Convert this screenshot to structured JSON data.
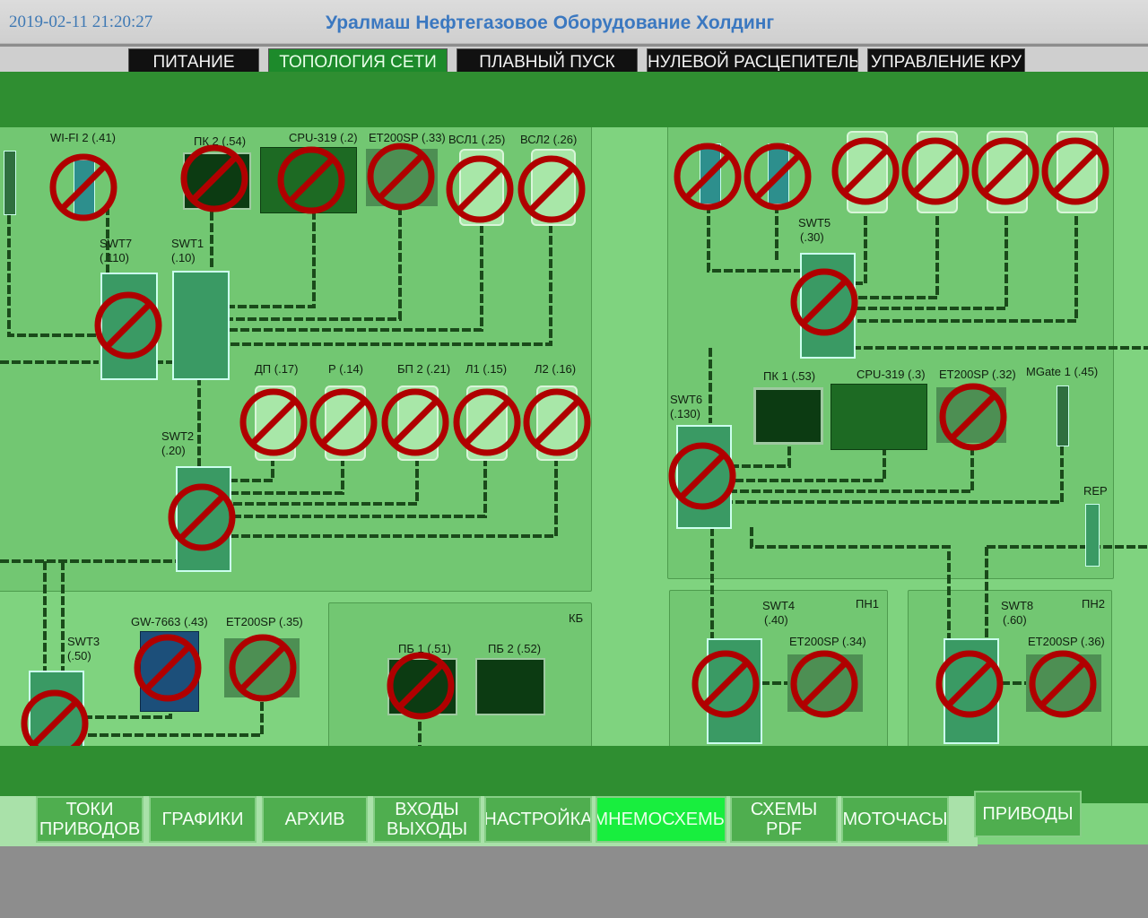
{
  "header": {
    "datetime": "2019-02-11 21:20:27",
    "company": "Уралмаш Нефтегазовое Оборудование Холдинг"
  },
  "top_tabs": [
    "ПИТАНИЕ",
    "ТОПОЛОГИЯ СЕТИ",
    "ПЛАВНЫЙ ПУСК",
    "НУЛЕВОЙ РАСЦЕПИТЕЛЬ",
    "УПРАВЛЕНИЕ КРУ"
  ],
  "top_tabs_active": "ТОПОЛОГИЯ СЕТИ",
  "labels": {
    "wifi2": "WI-FI 2  (.41)",
    "pk2": "ПК 2 (.54)",
    "cpu319_2": "CPU-319 (.2)",
    "et200sp_33": "ET200SP (.33)",
    "vsl1": "ВСЛ1 (.25)",
    "vsl2": "ВСЛ2 (.26)",
    "swt7": "SWT7",
    "swt7_ip": "(.110)",
    "swt1": "SWT1",
    "swt1_ip": "(.10)",
    "dp": "ДП (.17)",
    "r": "Р (.14)",
    "bp2": "БП 2 (.21)",
    "l1": "Л1 (.15)",
    "l2": "Л2 (.16)",
    "swt2": "SWT2",
    "swt2_ip": "(.20)",
    "gw7663": "GW-7663 (.43)",
    "et200sp_35": "ET200SP (.35)",
    "swt3": "SWT3",
    "swt3_ip": "(.50)",
    "kb": "КБ",
    "pb1": "ПБ 1 (.51)",
    "pb2": "ПБ 2 (.52)",
    "swt5": "SWT5",
    "swt5_ip": "(.30)",
    "pk1": "ПК 1 (.53)",
    "cpu319_3": "CPU-319 (.3)",
    "et200sp_32": "ET200SP (.32)",
    "mgate1": "MGate 1 (.45)",
    "swt6": "SWT6",
    "swt6_ip": "(.130)",
    "rep": "REP",
    "swt4": "SWT4",
    "swt4_ip": "(.40)",
    "pn1": "ПН1",
    "et200sp_34": "ET200SP (.34)",
    "swt8": "SWT8",
    "swt8_ip": "(.60)",
    "pn2": "ПН2",
    "et200sp_36": "ET200SP (.36)"
  },
  "bottom_nav": [
    {
      "line1": "ТОКИ",
      "line2": "ПРИВОДОВ",
      "active": false
    },
    {
      "line1": "ГРАФИКИ",
      "line2": "",
      "active": false
    },
    {
      "line1": "АРХИВ",
      "line2": "",
      "active": false
    },
    {
      "line1": "ВХОДЫ",
      "line2": "ВЫХОДЫ",
      "active": false
    },
    {
      "line1": "НАСТРОЙКА",
      "line2": "",
      "active": false
    },
    {
      "line1": "МНЕМОСХЕМЫ",
      "line2": "",
      "active": true
    },
    {
      "line1": "СХЕМЫ",
      "line2": "PDF",
      "active": false
    },
    {
      "line1": "МОТОЧАСЫ",
      "line2": "",
      "active": false
    },
    {
      "line1": "ПРИВОДЫ",
      "line2": "",
      "active": false
    }
  ],
  "colors": {
    "accent_active": "#1d8a2b",
    "fault_sign": "#b00000",
    "panel": "#72c772",
    "cable": "#1a4a1a"
  },
  "icons": {
    "fault": "prohibited-sign-icon",
    "switch": "network-switch-icon",
    "drive": "drive-panel-icon",
    "io": "io-module-icon",
    "pc": "monitor-icon"
  }
}
